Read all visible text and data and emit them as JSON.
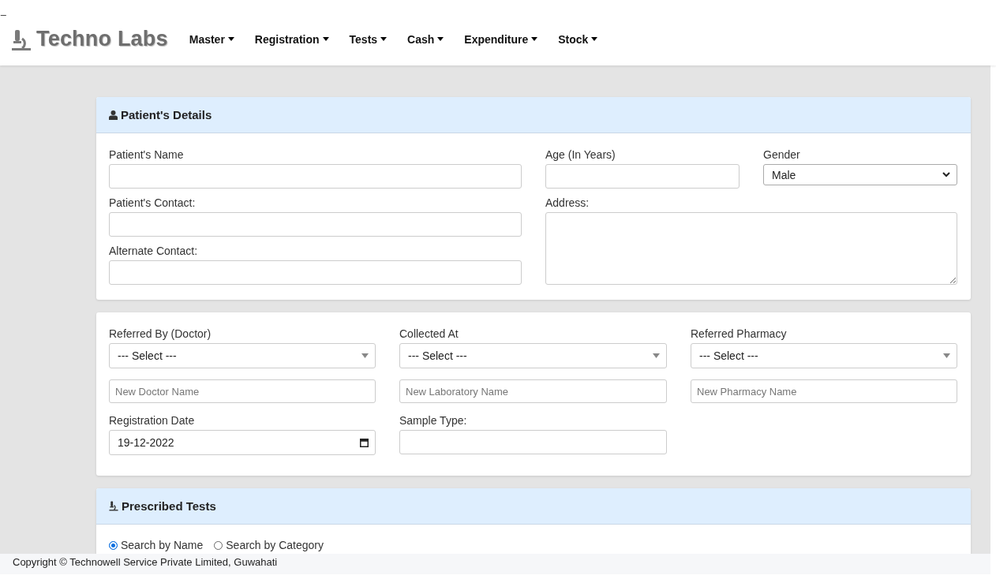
{
  "top_mark": "_",
  "brand": {
    "name": "Techno Labs"
  },
  "nav": [
    {
      "label": "Master"
    },
    {
      "label": "Registration"
    },
    {
      "label": "Tests"
    },
    {
      "label": "Cash"
    },
    {
      "label": "Expenditure"
    },
    {
      "label": "Stock"
    }
  ],
  "patient_details": {
    "title": "Patient's Details",
    "name": {
      "label": "Patient's Name"
    },
    "age": {
      "label": "Age (In Years)"
    },
    "gender": {
      "label": "Gender",
      "value": "Male"
    },
    "contact": {
      "label": "Patient's Contact:"
    },
    "address": {
      "label": "Address:"
    },
    "alternate_contact": {
      "label": "Alternate Contact:"
    }
  },
  "referral": {
    "columns": [
      {
        "label": "Referred By (Doctor)",
        "value": "--- Select ---",
        "new_placeholder": "New Doctor Name"
      },
      {
        "label": "Collected At",
        "value": "--- Select ---",
        "new_placeholder": "New Laboratory Name"
      },
      {
        "label": "Referred Pharmacy",
        "value": "--- Select ---",
        "new_placeholder": "New Pharmacy Name"
      }
    ],
    "registration_date": {
      "label": "Registration Date",
      "value": "19-12-2022"
    },
    "sample_type": {
      "label": "Sample Type:"
    }
  },
  "prescribed_tests": {
    "title": "Prescribed Tests",
    "search_modes": [
      {
        "label": "Search by Name",
        "selected": true
      },
      {
        "label": "Search by Category",
        "selected": false
      }
    ]
  },
  "footer": {
    "text": "Copyright © Technowell Service Private Limited, Guwahati"
  }
}
